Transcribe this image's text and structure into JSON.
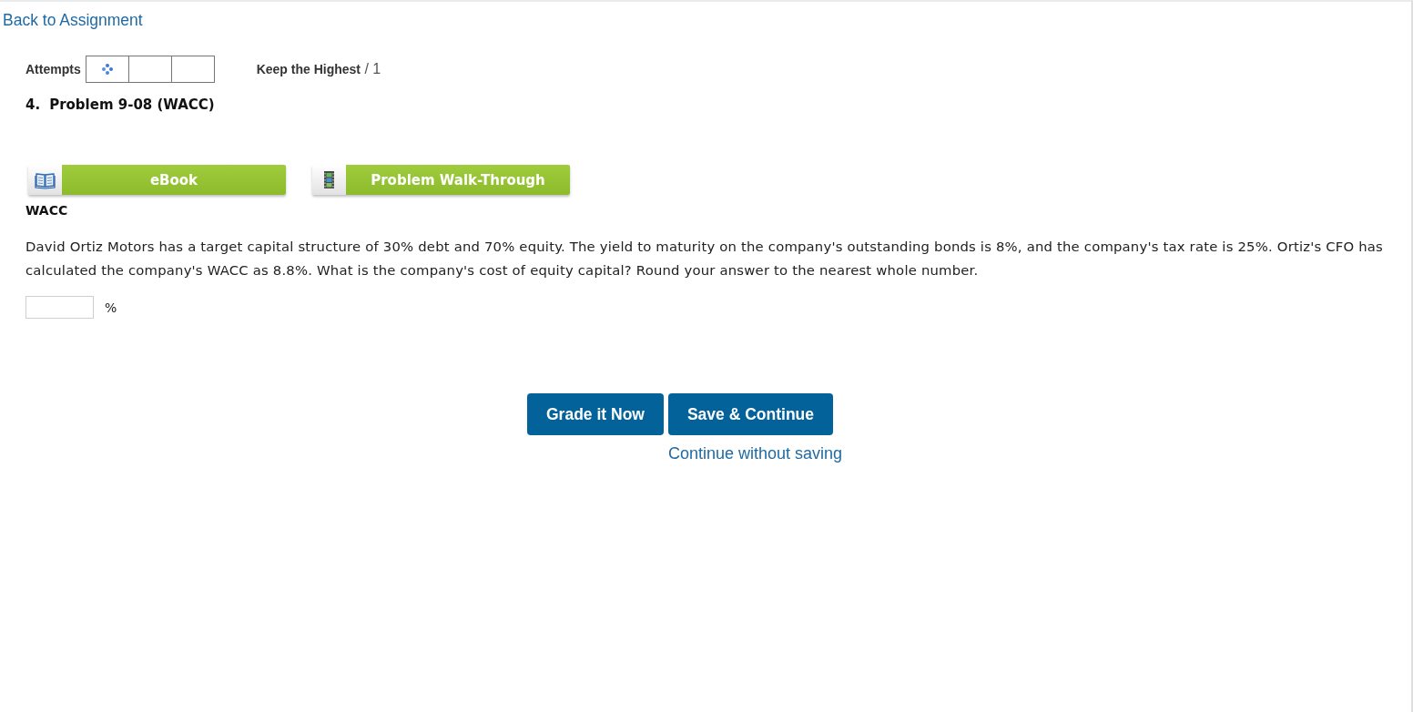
{
  "nav": {
    "back_link": "Back to Assignment"
  },
  "attempts": {
    "label": "Attempts",
    "boxes": [
      {
        "kind": "in-progress"
      },
      {
        "kind": "empty"
      },
      {
        "kind": "empty"
      }
    ],
    "policy": "**Keep the Highest** / 1"
  },
  "problem": {
    "number": "4.",
    "title": "Problem 9-08 (WACC)",
    "resources": [
      {
        "kind": "book",
        "label": "eBook"
      },
      {
        "kind": "film",
        "label": "Problem Walk-Through"
      }
    ],
    "heading": "WACC",
    "text": "David Ortiz Motors has a target capital structure of 30% debt and 70% equity. The yield to maturity on the company's outstanding bonds is 8%, and the company's tax rate is 25%. Ortiz's CFO has calculated the company's WACC as 8.8%. What is the company's cost of equity capital? Round your answer to the nearest whole number.",
    "answer": {
      "unit": "%"
    }
  },
  "actions": {
    "buttons": [
      "Grade it Now",
      "Save & Continue"
    ],
    "link": "Continue without saving"
  }
}
